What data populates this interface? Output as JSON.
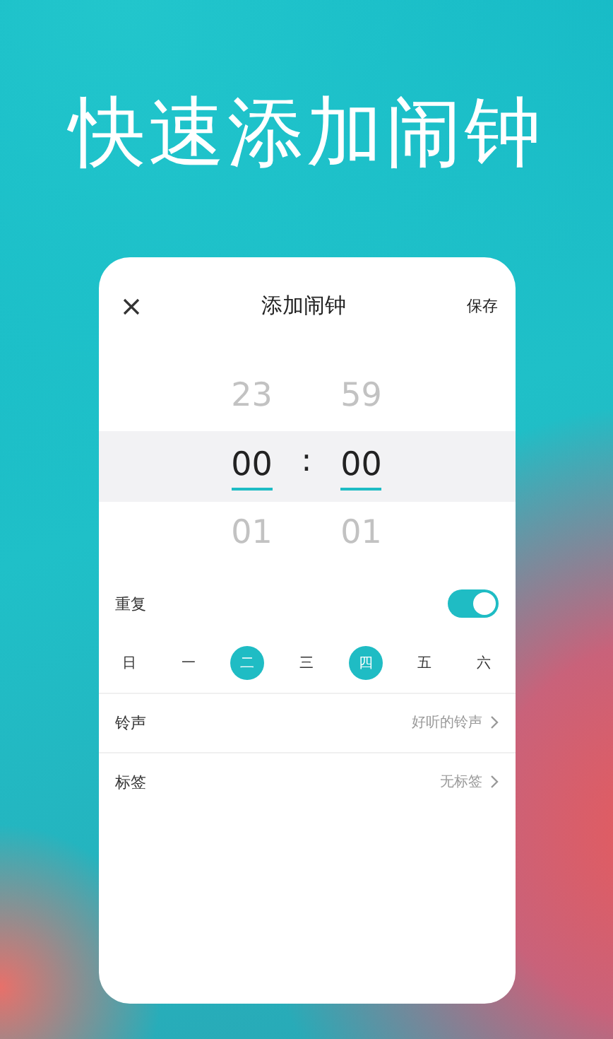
{
  "headline": "快速添加闹钟",
  "header": {
    "title": "添加闹钟",
    "action": "保存"
  },
  "picker": {
    "separator": ":",
    "columns": [
      {
        "above": "23",
        "value": "00",
        "below": "01"
      },
      {
        "above": "59",
        "value": "00",
        "below": "01"
      }
    ]
  },
  "repeat": {
    "label": "重复",
    "on": true
  },
  "days": [
    {
      "label": "日",
      "selected": false
    },
    {
      "label": "一",
      "selected": false
    },
    {
      "label": "二",
      "selected": true
    },
    {
      "label": "三",
      "selected": false
    },
    {
      "label": "四",
      "selected": true
    },
    {
      "label": "五",
      "selected": false
    },
    {
      "label": "六",
      "selected": false
    }
  ],
  "settings": [
    {
      "label": "铃声",
      "value": "好听的铃声"
    },
    {
      "label": "标签",
      "value": "无标签"
    }
  ]
}
